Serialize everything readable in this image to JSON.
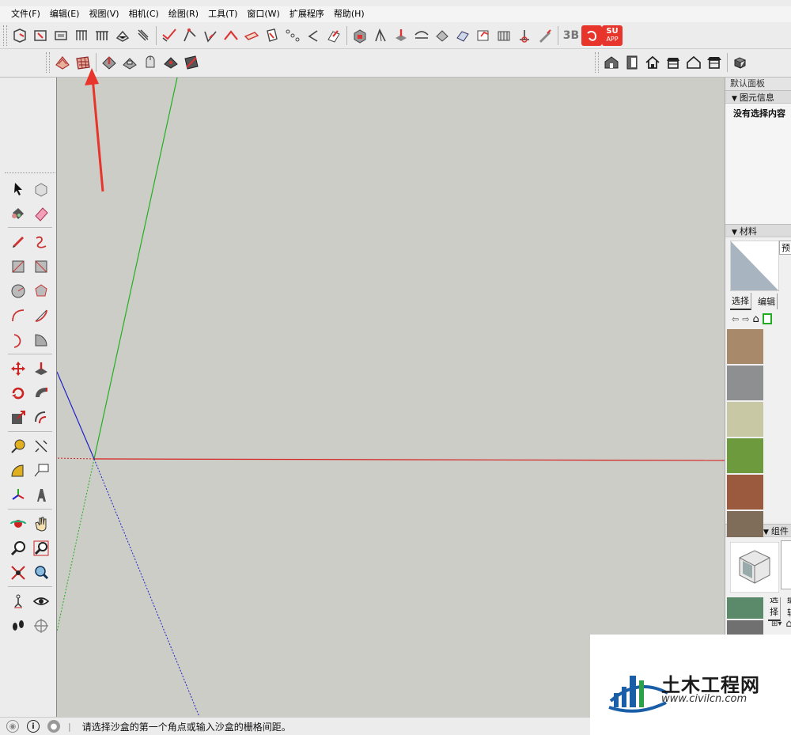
{
  "menu": {
    "items": [
      "文件(F)",
      "编辑(E)",
      "视图(V)",
      "相机(C)",
      "绘图(R)",
      "工具(T)",
      "窗口(W)",
      "扩展程序",
      "帮助(H)"
    ]
  },
  "toolbar": {
    "su_badge": "SU",
    "app_badge": "APP",
    "badge_3b": "3B"
  },
  "tray": {
    "title": "默认面板",
    "entity_info": {
      "header": "图元信息",
      "body": "没有选择内容"
    },
    "materials": {
      "header": "材料",
      "preview_label": "预",
      "tabs": [
        "选择",
        "编辑"
      ],
      "swatch_colors": [
        "#a8896a",
        "#8d8f90",
        "#c8c9a4",
        "#6c9a3c",
        "#9b5a3e",
        "#7f6d59",
        "#dedede",
        "#5a8a6a",
        "#707070",
        "#b8702a",
        "#4f7a3a",
        "#d9c9a8"
      ]
    },
    "components": {
      "header": "组件",
      "tabs": [
        "选择",
        "编辑"
      ]
    }
  },
  "status": {
    "text": "请选择沙盒的第一个角点或输入沙盒的栅格间距。",
    "sep": "|"
  },
  "watermark": {
    "title": "土木工程网",
    "url": "www.civilcn.com"
  },
  "colors": {
    "accent_red": "#e8352b",
    "axis_red": "#d42020",
    "axis_green": "#22b020",
    "axis_blue": "#2020c8",
    "viewport_bg": "#cdcdc7",
    "watermark_blue": "#1a5ea8"
  }
}
